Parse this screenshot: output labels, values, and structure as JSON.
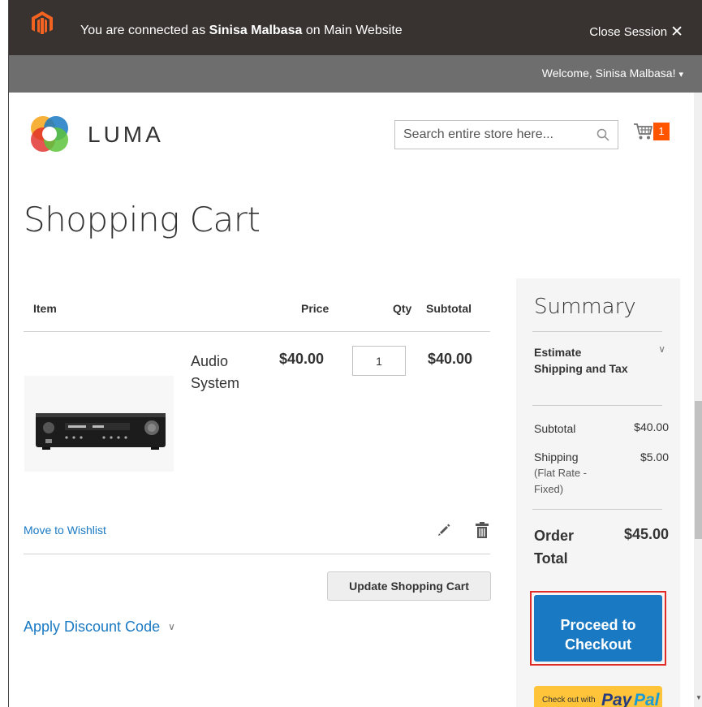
{
  "admin_bar": {
    "prefix": "You are connected as",
    "user": "Sinisa Malbasa",
    "suffix": "on Main Website",
    "close_label": "Close Session"
  },
  "welcome": "Welcome, Sinisa Malbasa!",
  "header": {
    "logo_text": "LUMA",
    "search_placeholder": "Search entire store here...",
    "cart_count": "1"
  },
  "page_title": "Shopping Cart",
  "cart_table": {
    "headers": [
      "Item",
      "Price",
      "Qty",
      "Subtotal"
    ],
    "items": [
      {
        "name": "Audio System",
        "price": "$40.00",
        "qty": "1",
        "subtotal": "$40.00"
      }
    ],
    "move_to_wishlist": "Move to Wishlist",
    "update_label": "Update Shopping Cart",
    "discount_label": "Apply Discount Code"
  },
  "summary": {
    "title": "Summary",
    "estimate_label": "Estimate Shipping and Tax",
    "subtotal_label": "Subtotal",
    "subtotal_value": "$40.00",
    "shipping_label": "Shipping",
    "shipping_method": "(Flat Rate - Fixed)",
    "shipping_value": "$5.00",
    "order_total_label": "Order Total",
    "order_total_value": "$45.00",
    "checkout_label": "Proceed to Checkout",
    "paypal_prefix": "Check out with",
    "paypal_pay": "Pay",
    "paypal_pal": "Pal"
  },
  "colors": {
    "admin_bar": "#383331",
    "welcome_bar": "#6e6e6e",
    "link": "#1979c3",
    "primary": "#1979c3",
    "cart_badge": "#ff5501",
    "highlight": "#e02b27",
    "paypal": "#ffc439"
  }
}
